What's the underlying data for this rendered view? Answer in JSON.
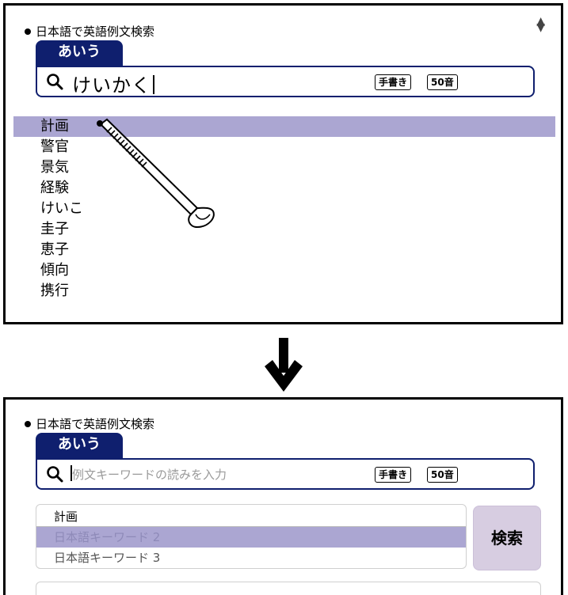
{
  "step1": {
    "mode_title": "日本語で英語例文検索",
    "kana_tab": "あいう",
    "search_value": "けいかく",
    "keyboard_buttons": {
      "handwriting": "手書き",
      "fifty_sound": "50音"
    },
    "candidates": [
      "計画",
      "警官",
      "景気",
      "経験",
      "けいこ",
      "圭子",
      "恵子",
      "傾向",
      "携行"
    ],
    "selected_index": 0
  },
  "step2": {
    "mode_title": "日本語で英語例文検索",
    "kana_tab": "あいう",
    "search_placeholder": "例文キーワードの読みを入力",
    "keyboard_buttons": {
      "handwriting": "手書き",
      "fifty_sound": "50音"
    },
    "keywords": [
      "計画",
      "日本語キーワード 2",
      "日本語キーワード 3"
    ],
    "search_button": "検索"
  },
  "colors": {
    "navy": "#0f1f6e",
    "highlight": "#aba6d2",
    "search_button_bg": "#d7cde1"
  },
  "icons": {
    "search": "magnifier-icon",
    "sort": "sort-updown-icon",
    "pen": "stylus-icon",
    "arrow": "down-arrow-icon"
  }
}
